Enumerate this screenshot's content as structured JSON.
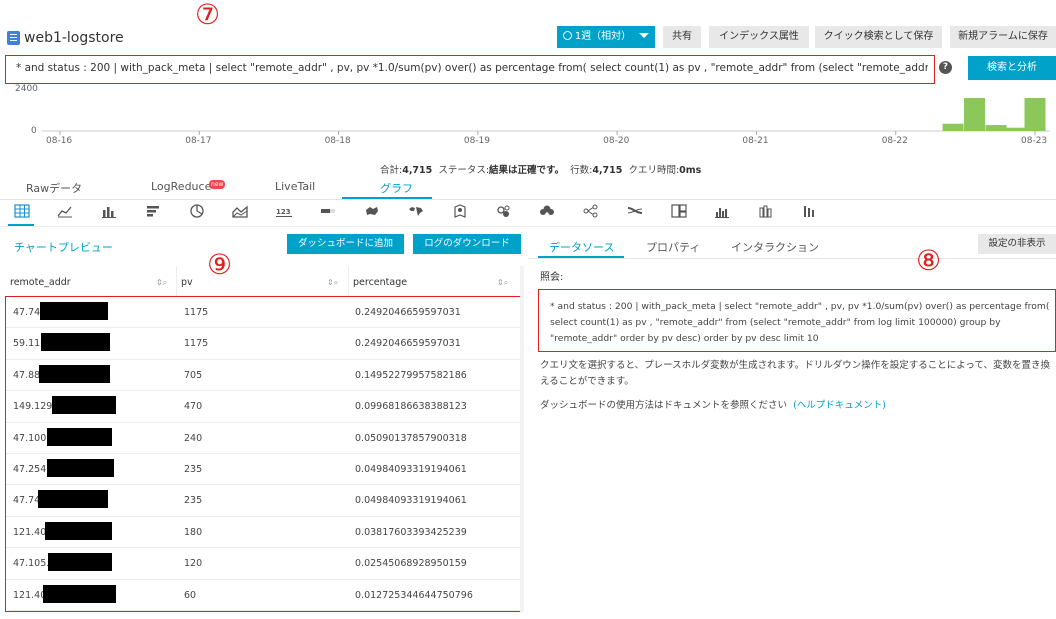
{
  "header": {
    "title": "web1-logstore",
    "time_range": "1週（相対）",
    "share": "共有",
    "index_attr": "インデックス属性",
    "save_quick_search": "クイック検索として保存",
    "new_alarm": "新規アラームに保存"
  },
  "callouts": {
    "seven": "⑦",
    "eight": "⑧",
    "nine": "⑨"
  },
  "query": {
    "text": "* and status : 200 | with_pack_meta | select \"remote_addr\" , pv, pv *1.0/sum(pv) over() as percentage from( select count(1) as pv , \"remote_addr\" from (select \"remote_addr\" from log limit 100000) group by \"remote_addr\" order by pv desc) order by pv desc limit 10",
    "search_button": "検索と分析",
    "help": "?"
  },
  "histogram": {
    "y_ticks": [
      "2400",
      "0"
    ],
    "x_ticks": [
      "08-16",
      "08-17",
      "08-18",
      "08-19",
      "08-20",
      "08-21",
      "08-22",
      "08-23"
    ],
    "bars": [
      {
        "pos": 0.916,
        "value": 0.22
      },
      {
        "pos": 0.938,
        "value": 1.0
      },
      {
        "pos": 0.96,
        "value": 0.18
      },
      {
        "pos": 0.98,
        "value": 0.1
      },
      {
        "pos": 1.0,
        "value": 1.0
      }
    ],
    "bar_color": "#8bc859"
  },
  "summary": {
    "total_label": "合計:",
    "total_value": "4,715",
    "status_label": "ステータス:",
    "status_value": "結果は正確です。",
    "rows_label": "行数:",
    "rows_value": "4,715",
    "query_time_label": "クエリ時間:",
    "query_time_value": "0ms"
  },
  "tabs": {
    "raw": "Rawデータ",
    "logreduce": "LogReduce",
    "logreduce_badge": "new",
    "livetail": "LiveTail",
    "graph": "グラフ"
  },
  "chart_icons": [
    "table-icon",
    "line-chart-icon",
    "column-chart-icon",
    "bar-chart-icon",
    "pie-chart-icon",
    "area-chart-icon",
    "number-icon",
    "progress-icon",
    "map-icon",
    "world-map-icon",
    "amap-icon",
    "flow-icon",
    "word-cloud-icon",
    "funnel-icon",
    "sankey-icon",
    "tree-icon",
    "heatmap-icon",
    "histogram-icon",
    "bar-compare-icon"
  ],
  "left_panel": {
    "preview_title": "チャートプレビュー",
    "add_dashboard": "ダッシュボードに追加",
    "download_log": "ログのダウンロード",
    "columns": [
      "remote_addr",
      "pv",
      "percentage"
    ],
    "rows": [
      {
        "addr": "47.74.",
        "pv": "1175",
        "pct": "0.2492046659597031"
      },
      {
        "addr": "59.110",
        "pv": "1175",
        "pct": "0.2492046659597031"
      },
      {
        "addr": "47.88.",
        "pv": "705",
        "pct": "0.14952279957582186"
      },
      {
        "addr": "149.129.",
        "pv": "470",
        "pct": "0.09968186638388123"
      },
      {
        "addr": "47.100.",
        "pv": "240",
        "pct": "0.05090137857900318"
      },
      {
        "addr": "47.254.",
        "pv": "235",
        "pct": "0.04984093319194061"
      },
      {
        "addr": "47.74",
        "pv": "235",
        "pct": "0.04984093319194061"
      },
      {
        "addr": "121.40.",
        "pv": "180",
        "pct": "0.03817603393425239"
      },
      {
        "addr": "47.105.",
        "pv": "120",
        "pct": "0.02545068928950159"
      },
      {
        "addr": "121.40.",
        "pv": "60",
        "pct": "0.012725344644750796"
      }
    ]
  },
  "right_panel": {
    "tab_datasource": "データソース",
    "tab_properties": "プロパティ",
    "tab_interaction": "インタラクション",
    "hide_settings": "設定の非表示",
    "query_label": "照会:",
    "query_text": "* and status : 200 | with_pack_meta | select \"remote_addr\" , pv, pv *1.0/sum(pv) over() as percentage from( select count(1) as pv , \"remote_addr\" from (select \"remote_addr\" from log limit 100000) group by \"remote_addr\" order by pv desc) order by pv desc limit 10",
    "placeholder_note": "クエリ文を選択すると、プレースホルダ変数が生成されます。ドリルダウン操作を設定することによって、変数を置き換えることができます。",
    "doc_note": "ダッシュボードの使用方法はドキュメントを参照ください",
    "help_link": "(ヘルプドキュメント)"
  }
}
